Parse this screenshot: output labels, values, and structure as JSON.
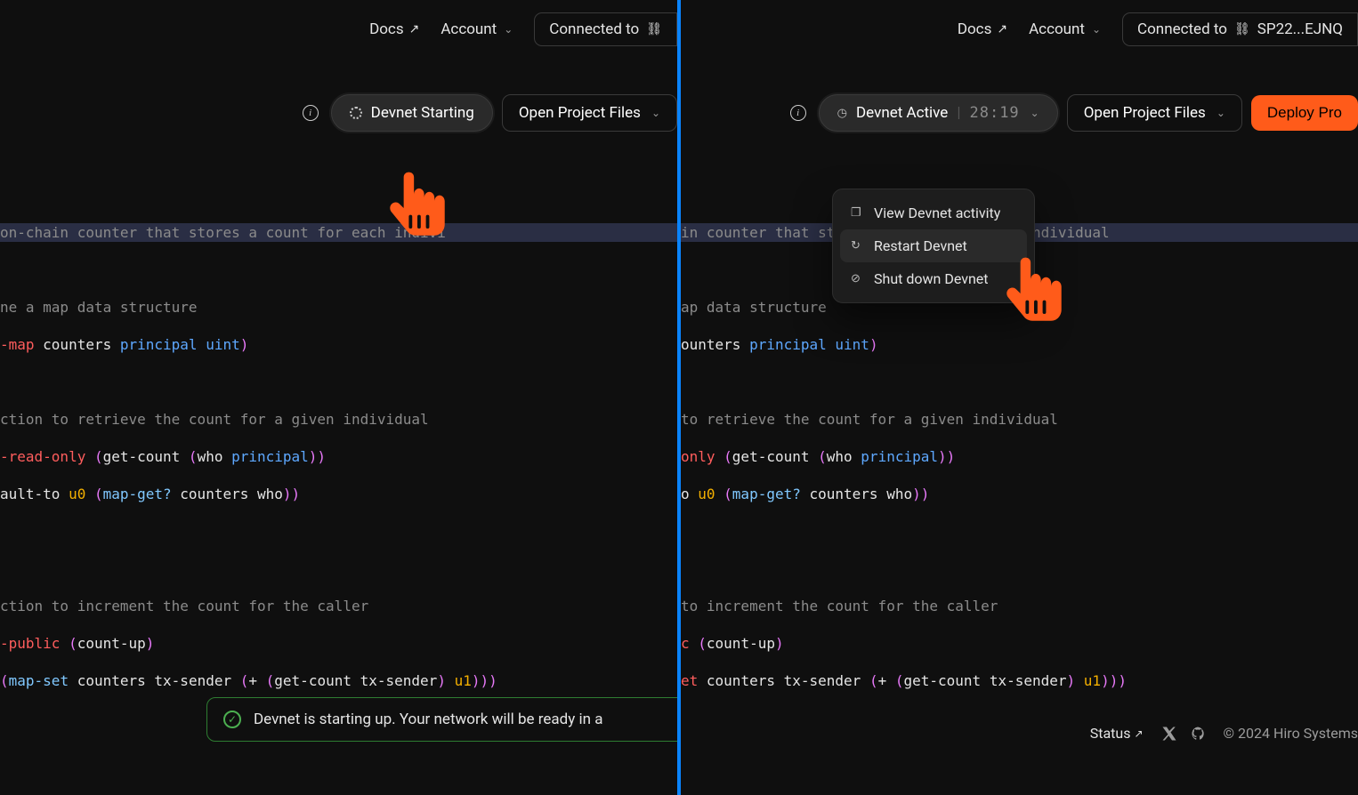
{
  "nav": {
    "docs": "Docs",
    "account": "Account",
    "connected_prefix": "Connected to",
    "wallet_short": "SP22...EJNQ"
  },
  "left": {
    "status_label": "Devnet Starting",
    "open_files": "Open Project Files",
    "toast": "Devnet is starting up. Your network will be ready in a"
  },
  "right": {
    "status_label": "Devnet Active",
    "timer": "28:19",
    "open_files": "Open Project Files",
    "deploy": "Deploy Pro",
    "menu": {
      "view": "View Devnet activity",
      "restart": "Restart Devnet",
      "shutdown": "Shut down Devnet"
    }
  },
  "code": {
    "l1_left": "on-chain counter that stores a count for each indivi",
    "l1_right": "in counter that stores a count for each individual",
    "l3": "ne a map data structure",
    "l3b": "ap data structure",
    "l4_kw": "-map",
    "l4_name": " counters ",
    "l4_t1": "principal",
    "l4_t2": " uint",
    "l4b_name": "ounters ",
    "l6": "ction to retrieve the count for a given individual",
    "l6b": "to retrieve the count for a given individual",
    "l7_kw": "-read-only",
    "l7_rest": " (get-count (who principal))",
    "l7b_kw": "only",
    "l8_pre": "ault-to ",
    "l8_num": "u0",
    "l8_mid": " (map-get? ",
    "l8_post": "counters who))",
    "l8b_pre": "o ",
    "l10": "ction to increment the count for the caller",
    "l10b": "to increment the count for the caller",
    "l11_kw": "-public",
    "l11_rest": " (count-up)",
    "l11b_kw": "c",
    "l12_pre": "(map-set ",
    "l12_mid": "counters tx-sender (+ (get-count tx-sender) ",
    "l12_num": "u1",
    "l12_post": ")))",
    "l12b_pre": "et "
  },
  "footer": {
    "status": "Status",
    "copyright": "© 2024 Hiro Systems"
  }
}
